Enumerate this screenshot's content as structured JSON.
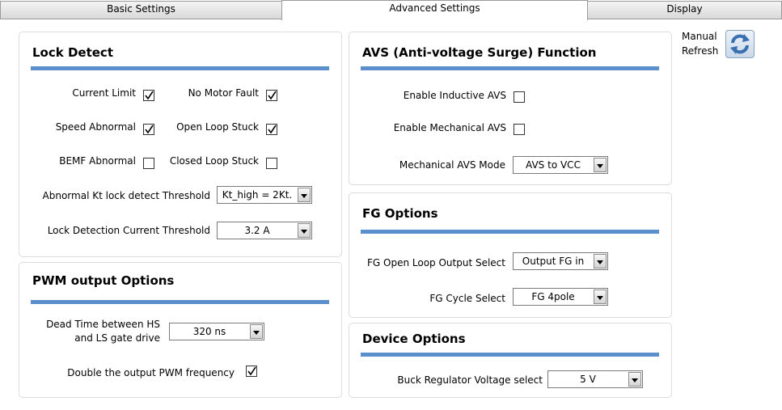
{
  "tabs": [
    {
      "label": "Basic Settings"
    },
    {
      "label": "Advanced Settings"
    },
    {
      "label": "Display"
    }
  ],
  "manual_refresh": {
    "line1": "Manual",
    "line2": "Refresh",
    "icon": "refresh-icon"
  },
  "lock_detect": {
    "title": "Lock Detect",
    "current_limit": {
      "label": "Current Limit",
      "checked": true
    },
    "no_motor_fault": {
      "label": "No Motor Fault",
      "checked": true
    },
    "speed_abnormal": {
      "label": "Speed Abnormal",
      "checked": true
    },
    "open_loop_stuck": {
      "label": "Open Loop Stuck",
      "checked": true
    },
    "bemf_abnormal": {
      "label": "BEMF Abnormal",
      "checked": false
    },
    "closed_loop_stuck": {
      "label": "Closed Loop Stuck",
      "checked": false
    },
    "kt_threshold": {
      "label": "Abnormal Kt lock detect Threshold",
      "value": "Kt_high = 2Kt."
    },
    "current_threshold": {
      "label": "Lock Detection Current Threshold",
      "value": "3.2 A"
    }
  },
  "pwm": {
    "title": "PWM output Options",
    "dead_time": {
      "label_line1": "Dead Time between HS",
      "label_line2": "and LS gate drive",
      "value": "320 ns"
    },
    "double_freq": {
      "label": "Double the output PWM frequency",
      "checked": true
    }
  },
  "avs": {
    "title": "AVS (Anti-voltage Surge) Function",
    "inductive": {
      "label": "Enable Inductive AVS",
      "checked": false
    },
    "mechanical": {
      "label": "Enable Mechanical AVS",
      "checked": false
    },
    "mode": {
      "label": "Mechanical AVS Mode",
      "value": "AVS to VCC"
    }
  },
  "fg": {
    "title": "FG Options",
    "open_loop": {
      "label": "FG Open Loop Output Select",
      "value": "Output FG in"
    },
    "cycle": {
      "label": "FG Cycle Select",
      "value": "FG 4pole"
    }
  },
  "device": {
    "title": "Device Options",
    "buck": {
      "label": "Buck Regulator Voltage select",
      "value": "5 V"
    }
  },
  "colors": {
    "accent_bar": "#5b8fcc",
    "panel_border": "#dcdcdc"
  }
}
